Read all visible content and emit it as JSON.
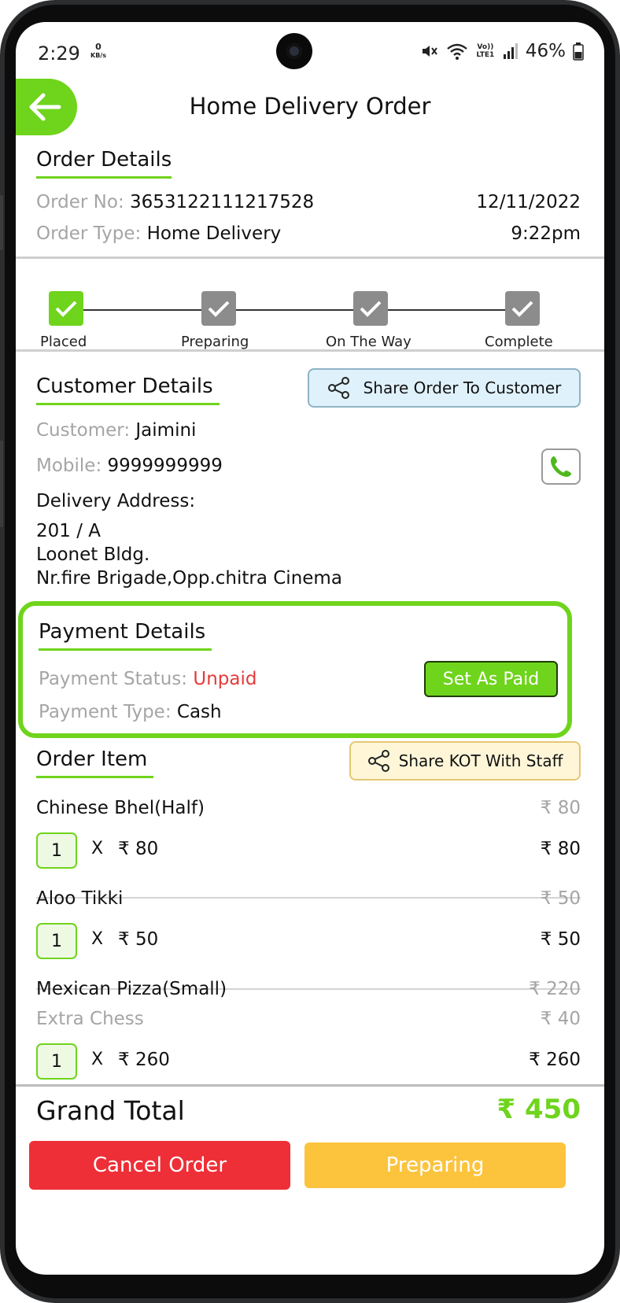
{
  "status_bar": {
    "time": "2:29",
    "data_rate": "0",
    "data_unit": "KB/s",
    "volte": "Vo)) LTE1",
    "battery": "46%"
  },
  "header": {
    "title": "Home Delivery Order"
  },
  "order_details": {
    "title": "Order Details",
    "order_no_label": "Order No:",
    "order_no": "3653122111217528",
    "date": "12/11/2022",
    "order_type_label": "Order Type:",
    "order_type": "Home Delivery",
    "time": "9:22pm"
  },
  "progress": {
    "steps": [
      {
        "label": "Placed",
        "done": true
      },
      {
        "label": "Preparing",
        "done": false
      },
      {
        "label": "On The Way",
        "done": false
      },
      {
        "label": "Complete",
        "done": false
      }
    ]
  },
  "customer": {
    "title": "Customer Details",
    "share_button": "Share Order To Customer",
    "customer_label": "Customer:",
    "customer_name": "Jaimini",
    "mobile_label": "Mobile:",
    "mobile": "9999999999",
    "address_label": "Delivery Address:",
    "address_lines": [
      "201 / A",
      "Loonet Bldg.",
      "Nr.fire Brigade,Opp.chitra Cinema"
    ]
  },
  "payment": {
    "title": "Payment Details",
    "status_label": "Payment Status:",
    "status": "Unpaid",
    "set_paid_button": "Set As Paid",
    "type_label": "Payment Type:",
    "type": "Cash"
  },
  "order_items": {
    "title": "Order Item",
    "share_kot_button": "Share KOT With Staff",
    "items": [
      {
        "name": "Chinese Bhel(Half)",
        "price": "₹ 80",
        "qty": "1",
        "x": "X",
        "unit_price": "₹ 80",
        "total": "₹ 80"
      },
      {
        "name": "Aloo Tikki",
        "price": "₹ 50",
        "qty": "1",
        "x": "X",
        "unit_price": "₹ 50",
        "total": "₹ 50"
      },
      {
        "name": "Mexican Pizza(Small)",
        "price": "₹ 220",
        "addon": "Extra Chess",
        "addon_price": "₹ 40",
        "qty": "1",
        "x": "X",
        "unit_price": "₹ 260",
        "total": "₹ 260"
      }
    ]
  },
  "footer": {
    "grand_total_label": "Grand Total",
    "grand_total": "₹ 450",
    "cancel_button": "Cancel Order",
    "preparing_button": "Preparing"
  },
  "colors": {
    "accent": "#6fd41c",
    "danger": "#ee2f37",
    "warning": "#fcc33d",
    "muted": "#a5a5a5"
  }
}
